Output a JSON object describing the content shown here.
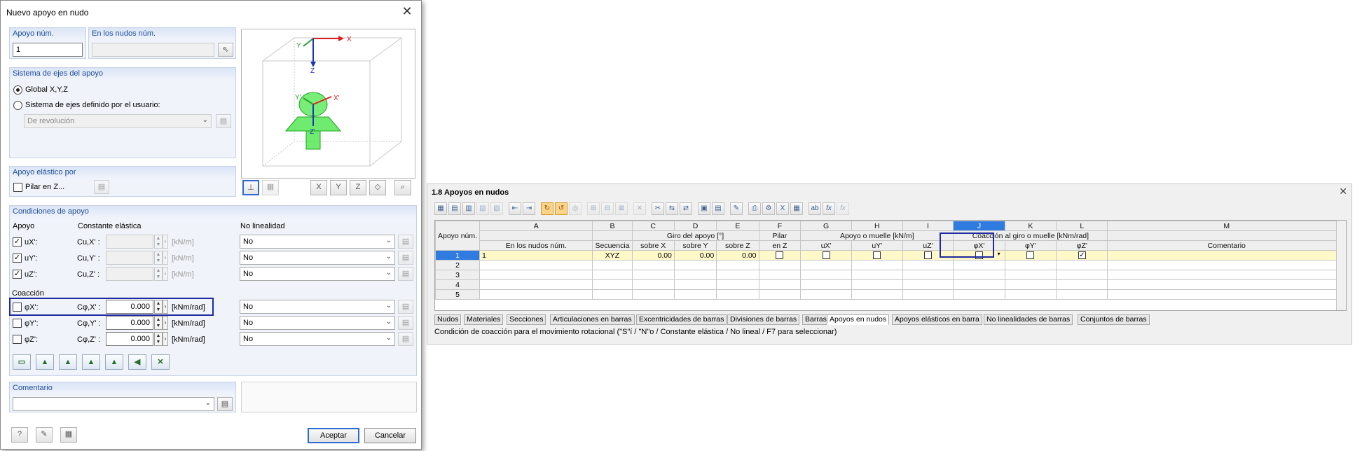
{
  "dialog": {
    "title": "Nuevo apoyo en nudo",
    "support_no_label": "Apoyo núm.",
    "support_no_value": "1",
    "nodes_label": "En los nudos núm.",
    "nodes_value": "",
    "axes_group": "Sistema de ejes del apoyo",
    "global_label": "Global X,Y,Z",
    "user_label": "Sistema de ejes definido por el usuario:",
    "user_combo": "De revolución",
    "elastic_group": "Apoyo elástico por",
    "column_label": "Pilar en Z...",
    "conditions_group": "Condiciones de apoyo",
    "col_support": "Apoyo",
    "col_elastic": "Constante elástica",
    "col_nonlin": "No linealidad",
    "translations": [
      {
        "label": "uX':",
        "const": "Cu,X' :",
        "value": "",
        "unit": "[kN/m]",
        "nonlin": "No",
        "checked": true
      },
      {
        "label": "uY':",
        "const": "Cu,Y' :",
        "value": "",
        "unit": "[kN/m]",
        "nonlin": "No",
        "checked": true
      },
      {
        "label": "uZ':",
        "const": "Cu,Z' :",
        "value": "",
        "unit": "[kN/m]",
        "nonlin": "No",
        "checked": true
      }
    ],
    "restraint_label": "Coacción",
    "rotations": [
      {
        "label": "φX':",
        "const": "Cφ,X' :",
        "value": "0.000",
        "unit": "[kNm/rad]",
        "nonlin": "No",
        "checked": false
      },
      {
        "label": "φY':",
        "const": "Cφ,Y' :",
        "value": "0.000",
        "unit": "[kNm/rad]",
        "nonlin": "No",
        "checked": false
      },
      {
        "label": "φZ':",
        "const": "Cφ,Z' :",
        "value": "0.000",
        "unit": "[kNm/rad]",
        "nonlin": "No",
        "checked": false
      }
    ],
    "comment_label": "Comentario",
    "comment_value": "",
    "ok_label": "Aceptar",
    "cancel_label": "Cancelar",
    "preview": {
      "axis_x": "X",
      "axis_y": "Y",
      "axis_z": "Z",
      "local_x": "X'",
      "local_y": "Y'",
      "local_z": "Z'"
    }
  },
  "table": {
    "title": "1.8 Apoyos en nudos",
    "col_letters": [
      "A",
      "B",
      "C",
      "D",
      "E",
      "F",
      "G",
      "H",
      "I",
      "J",
      "K",
      "L",
      "M"
    ],
    "hdr_row_label": "Apoyo núm.",
    "hdr_rotation": "Giro del apoyo [°]",
    "hdr_column": "Pilar",
    "hdr_spring": "Apoyo o muelle [kN/m]",
    "hdr_restraint": "Coacción al giro o muelle [kNm/rad]",
    "sub_nodes": "En los nudos núm.",
    "sub_sequence": "Secuencia",
    "sub_x": "sobre X",
    "sub_y": "sobre Y",
    "sub_z": "sobre Z",
    "sub_enz": "en Z",
    "sub_ux": "uX'",
    "sub_uy": "uY'",
    "sub_uz": "uZ'",
    "sub_px": "φX'",
    "sub_py": "φY'",
    "sub_pz": "φZ'",
    "sub_comment": "Comentario",
    "rows": [
      {
        "n": "1",
        "nodes": "1",
        "seq": "XYZ",
        "rx": "0.00",
        "ry": "0.00",
        "rz": "0.00"
      },
      {
        "n": "2"
      },
      {
        "n": "3"
      },
      {
        "n": "4"
      },
      {
        "n": "5"
      }
    ],
    "tabs": [
      "Nudos",
      "Materiales",
      "Secciones",
      "Articulaciones en barras",
      "Excentricidades de barras",
      "Divisiones de barras",
      "Barras",
      "Apoyos en nudos",
      "Apoyos elásticos en barra",
      "No linealidades de barras",
      "Conjuntos de barras"
    ],
    "active_tab": "Apoyos en nudos",
    "status": "Condición de coacción para el movimiento rotacional (\"S\"í / \"N\"o / Constante elástica / No lineal / F7 para seleccionar)"
  },
  "colors": {
    "accent": "#1f4e9a",
    "highlight": "#1e2aa0",
    "selected_col": "#2f7be0",
    "current_row": "#fff8c8",
    "green": "#2ecc40"
  }
}
